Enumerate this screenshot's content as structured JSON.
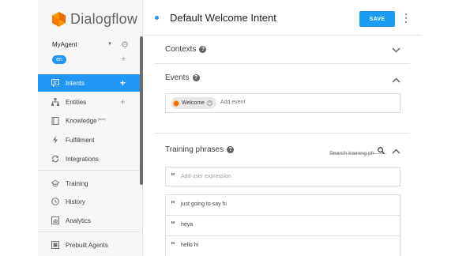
{
  "app": {
    "name": "Dialogflow"
  },
  "agent": {
    "name": "MyAgent",
    "language": "en"
  },
  "sidebar": {
    "items": [
      {
        "label": "Intents",
        "icon": "intents-icon",
        "active": true,
        "has_add": true
      },
      {
        "label": "Entities",
        "icon": "entities-icon",
        "active": false,
        "has_add": true
      },
      {
        "label": "Knowledge",
        "sup": "[beta]",
        "icon": "knowledge-icon",
        "active": false
      },
      {
        "label": "Fulfillment",
        "icon": "fulfillment-icon",
        "active": false
      },
      {
        "label": "Integrations",
        "icon": "integrations-icon",
        "active": false
      },
      {
        "label": "Training",
        "icon": "training-icon",
        "active": false
      },
      {
        "label": "History",
        "icon": "history-icon",
        "active": false
      },
      {
        "label": "Analytics",
        "icon": "analytics-icon",
        "active": false
      },
      {
        "label": "Prebuilt Agents",
        "icon": "prebuilt-agents-icon",
        "active": false
      }
    ]
  },
  "header": {
    "title": "Default Welcome Intent",
    "save_label": "SAVE"
  },
  "sections": {
    "contexts": {
      "title": "Contexts"
    },
    "events": {
      "title": "Events",
      "chips": [
        {
          "label": "Welcome"
        }
      ],
      "add_placeholder": "Add event"
    },
    "training": {
      "title": "Training phrases",
      "search_placeholder": "Search training ph",
      "add_placeholder": "Add user expression",
      "phrases": [
        "just going to say hi",
        "heya",
        "hello hi"
      ]
    }
  },
  "colors": {
    "accent": "#2196f3",
    "save_button": "#1a9bf0",
    "logo_orange": "#ef6c00",
    "sidebar_bg": "#f7f7f7"
  }
}
